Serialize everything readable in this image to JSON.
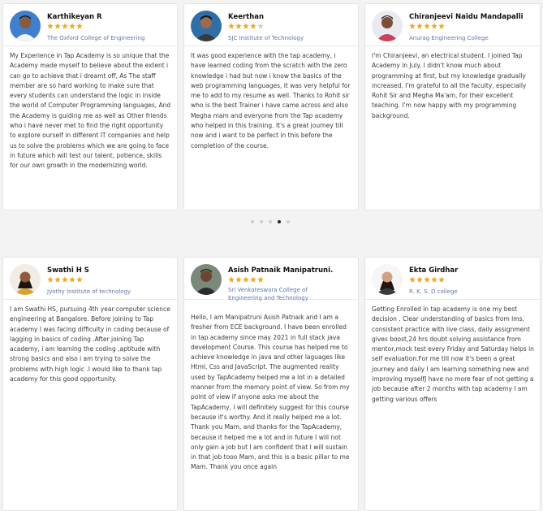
{
  "row1": [
    {
      "name": "Karthikeyan R",
      "college": "The Oxford College of Engineering",
      "rating": 5,
      "review": "My Experience in Tap Academy is so unique that the Academy made myself to believe about the extent i can go to achieve that i dreamt off, As The staff member are so hard working to make sure that every students can understand the logic in inside the world of Computer Programming languages, And the Academy is guiding me as well as Other friends who i have never met to find the right opportunity to explore ourself in different IT companies and help us to solve the problems which we are going to face in future which will test our talent, potience, skills for our own growth in the modernizing world."
    },
    {
      "name": "Keerthan",
      "college": "SJC Institute of Technology",
      "rating": 4,
      "review": "It was good experience with the tap academy, i have learned coding from the scratch with the zero knowledge i had but now i know the basics of the web programming languages, it was very helpful for me to add to my resume as well. Thanks to Rohit sir who is the best Trainer i have came across and also Megha mam and everyone from the Tap academy who helped in this training. It's a great journey till now and i want to be perfect in this before the completion of the course."
    },
    {
      "name": "Chiranjeevi Naidu Mandapalli",
      "college": "Anurag Engineering College",
      "rating": 5,
      "review": "I'm Chiranjeevi, an electrical student. I joined Tap Academy in July. I didn't know much about programming at first, but my knowledge gradually increased. I'm grateful to all the faculty, especially Rohit Sir and Megha Ma'am, for their excellent teaching. I'm now happy with my programming background."
    }
  ],
  "row2": [
    {
      "name": "Swathi H S",
      "college": "Jyothy Institute of technology",
      "rating": 5,
      "review": "I am Swathi HS, pursuing 4th year computer science engineering at Bangalore. Before joining to Tap academy I was facing difficulty in coding because of lagging in basics of coding .After joining Tap academy, i am learning the coding ,aptitude with strong basics and also i am trying to solve the problems with high logic .I would like to thank tap academy for this good opportunity."
    },
    {
      "name": "Asish Patnaik Manipatruni.",
      "college": "Sri Venkateswara College of Engineering and Technology",
      "rating": 5,
      "review": "Hello, I am Manipatruni Asish Patnaik and I am a fresher from ECE background. I have been enrolled in tap academy since may 2021 in full stack java development Course. This course has helped me to achieve knowledge in java and other laguages like Html, Css and JavaScript. The augmented reality used by TapAcademy helped me a lot in a detailed manner from the memory point of view. So from my point of view if anyone asks me about the TapAcademy, I will definitely suggest for this course because it's worthy. And it really helped me a lot. Thank you Mam, and thanks for the TapAcademy, because it helped me a lot and in future I will not only gain a job but I am confident that I will sustain in that job tooo Mam, and this is a basic pillar to me Mam. Thank you once again"
    },
    {
      "name": "Ekta Girdhar",
      "college": "R. K. S. D college",
      "rating": 5,
      "review": "Getting Enrolled in tap academy is one my best decision . Clear understanding of basics from lms, consistent practice with live class, daily assignment gives boost,24 hrs doubt solving assistance from mentor,mock test every Friday and Saturday helps in self evaluation.For me till now it's been a great journey and daily I am learning something new and improving myselfJ have no more fear of not getting a job because after 2 months with tap academy I am getting various offers"
    }
  ],
  "carousel": {
    "dot_count": 5,
    "active_dot": 4
  },
  "colors": {
    "star": "#f2a91c",
    "star_empty": "#cfcfcf",
    "college": "#5b77a8",
    "card_border": "#e4e4e4",
    "background": "#f3f3f3"
  }
}
